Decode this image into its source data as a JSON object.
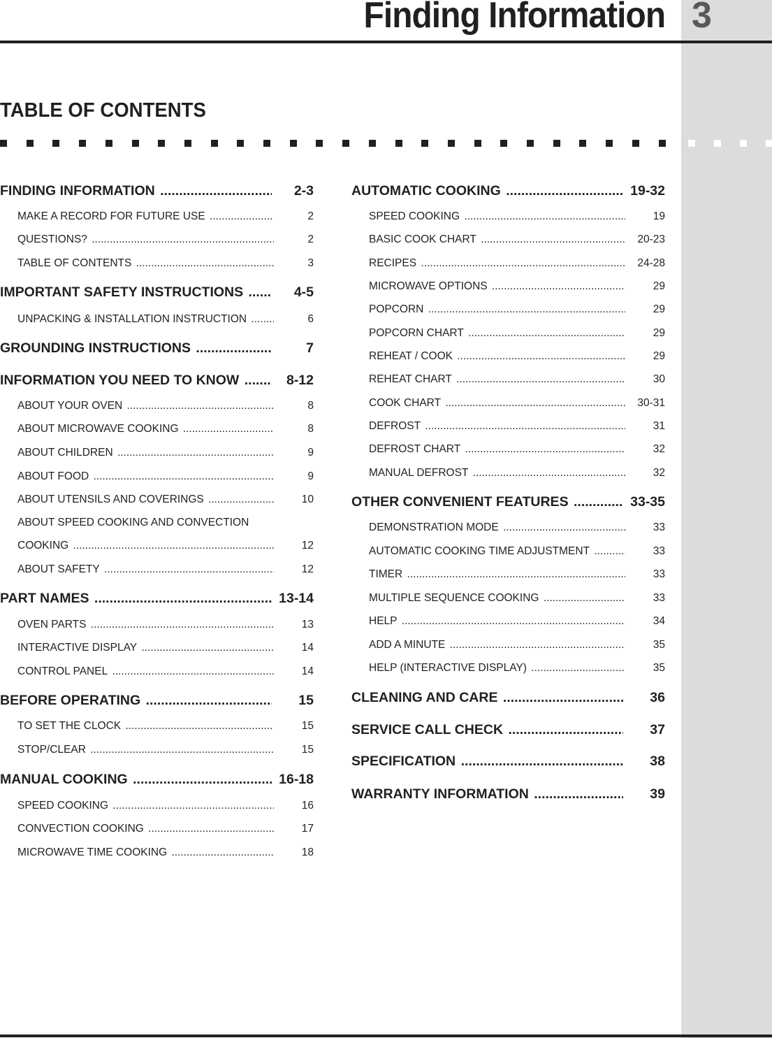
{
  "header": {
    "title": "Finding Information",
    "chapter_number": "3"
  },
  "toc_heading": "TABLE OF CONTENTS",
  "left_column": [
    {
      "level": "h",
      "label": "FINDING INFORMATION",
      "page": "2-3"
    },
    {
      "level": "s",
      "label": "MAKE A RECORD FOR FUTURE USE",
      "page": "2"
    },
    {
      "level": "s",
      "label": "QUESTIONS?",
      "page": "2"
    },
    {
      "level": "s",
      "label": "TABLE OF CONTENTS",
      "page": "3"
    },
    {
      "level": "h",
      "label": "IMPORTANT SAFETY INSTRUCTIONS",
      "page": "4-5"
    },
    {
      "level": "s",
      "label": "UNPACKING & INSTALLATION INSTRUCTION",
      "page": "6"
    },
    {
      "level": "h",
      "label": "GROUNDING INSTRUCTIONS",
      "page": "7"
    },
    {
      "level": "h",
      "label": "INFORMATION YOU NEED TO KNOW",
      "page": "8-12"
    },
    {
      "level": "s",
      "label": "ABOUT YOUR OVEN",
      "page": "8"
    },
    {
      "level": "s",
      "label": "ABOUT MICROWAVE COOKING",
      "page": "8"
    },
    {
      "level": "s",
      "label": "ABOUT CHILDREN",
      "page": "9"
    },
    {
      "level": "s",
      "label": "ABOUT FOOD",
      "page": "9"
    },
    {
      "level": "s",
      "label": "ABOUT UTENSILS AND COVERINGS",
      "page": "10"
    },
    {
      "level": "s",
      "label": "ABOUT SPEED COOKING AND CONVECTION",
      "page": ""
    },
    {
      "level": "s",
      "label": "COOKING",
      "page": "12"
    },
    {
      "level": "s",
      "label": "ABOUT SAFETY",
      "page": "12"
    },
    {
      "level": "h",
      "label": "PART NAMES",
      "page": "13-14"
    },
    {
      "level": "s",
      "label": "OVEN PARTS",
      "page": "13"
    },
    {
      "level": "s",
      "label": "INTERACTIVE DISPLAY",
      "page": "14"
    },
    {
      "level": "s",
      "label": "CONTROL PANEL",
      "page": "14"
    },
    {
      "level": "h",
      "label": "BEFORE OPERATING",
      "page": "15"
    },
    {
      "level": "s",
      "label": "TO SET THE CLOCK",
      "page": "15"
    },
    {
      "level": "s",
      "label": "STOP/CLEAR",
      "page": "15"
    },
    {
      "level": "h",
      "label": "MANUAL COOKING",
      "page": "16-18"
    },
    {
      "level": "s",
      "label": "SPEED COOKING",
      "page": "16"
    },
    {
      "level": "s",
      "label": "CONVECTION COOKING",
      "page": "17"
    },
    {
      "level": "s",
      "label": "MICROWAVE TIME COOKING",
      "page": "18"
    }
  ],
  "right_column": [
    {
      "level": "h",
      "label": "AUTOMATIC COOKING",
      "page": "19-32"
    },
    {
      "level": "s",
      "label": "SPEED COOKING",
      "page": "19"
    },
    {
      "level": "s",
      "label": "BASIC COOK CHART",
      "page": "20-23"
    },
    {
      "level": "s",
      "label": "RECIPES",
      "page": "24-28"
    },
    {
      "level": "s",
      "label": "MICROWAVE OPTIONS",
      "page": "29"
    },
    {
      "level": "s",
      "label": "POPCORN",
      "page": "29"
    },
    {
      "level": "s",
      "label": "POPCORN CHART",
      "page": "29"
    },
    {
      "level": "s",
      "label": "REHEAT / COOK",
      "page": "29"
    },
    {
      "level": "s",
      "label": "REHEAT CHART",
      "page": "30"
    },
    {
      "level": "s",
      "label": "COOK CHART",
      "page": "30-31"
    },
    {
      "level": "s",
      "label": "DEFROST",
      "page": "31"
    },
    {
      "level": "s",
      "label": "DEFROST CHART",
      "page": "32"
    },
    {
      "level": "s",
      "label": "MANUAL DEFROST",
      "page": "32"
    },
    {
      "level": "h",
      "label": "OTHER CONVENIENT FEATURES",
      "page": "33-35"
    },
    {
      "level": "s",
      "label": "DEMONSTRATION MODE",
      "page": "33"
    },
    {
      "level": "s",
      "label": "AUTOMATIC COOKING TIME ADJUSTMENT",
      "page": "33"
    },
    {
      "level": "s",
      "label": "TIMER",
      "page": "33"
    },
    {
      "level": "s",
      "label": "MULTIPLE SEQUENCE COOKING",
      "page": "33"
    },
    {
      "level": "s",
      "label": "HELP",
      "page": "34"
    },
    {
      "level": "s",
      "label": "ADD A MINUTE",
      "page": "35"
    },
    {
      "level": "s",
      "label": "HELP (INTERACTIVE DISPLAY)",
      "page": "35"
    },
    {
      "level": "h",
      "label": "CLEANING AND CARE",
      "page": "36"
    },
    {
      "level": "h",
      "label": "SERVICE CALL CHECK",
      "page": "37"
    },
    {
      "level": "h",
      "label": "SPECIFICATION",
      "page": "38"
    },
    {
      "level": "h",
      "label": "WARRANTY INFORMATION",
      "page": "39"
    }
  ]
}
